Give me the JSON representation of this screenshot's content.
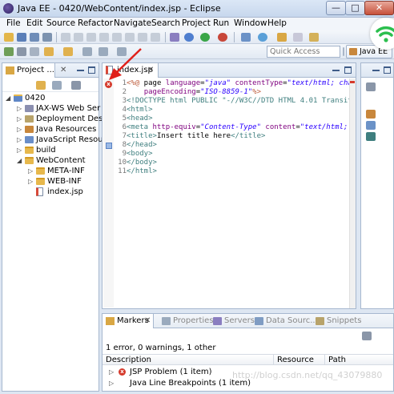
{
  "window": {
    "title": "Java EE - 0420/WebContent/index.jsp - Eclipse",
    "min_label": "—",
    "max_label": "□",
    "close_label": "✕"
  },
  "menu": {
    "items": [
      "File",
      "Edit",
      "Source",
      "Refactor",
      "Navigate",
      "Search",
      "Project",
      "Run",
      "Window",
      "Help"
    ]
  },
  "toolbar": {
    "quick_access_placeholder": "Quick Access",
    "perspective_label": "Java EE"
  },
  "project_explorer": {
    "tab_label": "Project ...",
    "tree": [
      {
        "label": "0420",
        "level": 0,
        "expanded": true,
        "icon": "project-icon"
      },
      {
        "label": "JAX-WS Web Ser",
        "level": 1,
        "expanded": false,
        "icon": "jaxws-icon"
      },
      {
        "label": "Deployment Desc",
        "level": 1,
        "expanded": false,
        "icon": "deployment-descriptor-icon"
      },
      {
        "label": "Java Resources",
        "level": 1,
        "expanded": false,
        "icon": "java-resources-icon"
      },
      {
        "label": "JavaScript Resou",
        "level": 1,
        "expanded": false,
        "icon": "javascript-resources-icon"
      },
      {
        "label": "build",
        "level": 1,
        "expanded": false,
        "icon": "folder-icon"
      },
      {
        "label": "WebContent",
        "level": 1,
        "expanded": true,
        "icon": "folder-icon"
      },
      {
        "label": "META-INF",
        "level": 2,
        "expanded": false,
        "icon": "folder-icon"
      },
      {
        "label": "WEB-INF",
        "level": 2,
        "expanded": false,
        "icon": "folder-icon"
      },
      {
        "label": "index.jsp",
        "level": 2,
        "expanded": null,
        "icon": "jsp-file-icon"
      }
    ]
  },
  "editor": {
    "tab_label": "index.jsp",
    "tab_close": "✕",
    "error_marker": "x",
    "lines": [
      {
        "n": "1",
        "parts": [
          [
            "dir",
            "<%@"
          ],
          [
            "txt",
            " page "
          ],
          [
            "attr",
            "language"
          ],
          [
            "txt",
            "="
          ],
          [
            "val",
            "\"java\""
          ],
          [
            "txt",
            " "
          ],
          [
            "attr",
            "contentType"
          ],
          [
            "txt",
            "="
          ],
          [
            "val",
            "\"text/html; char"
          ]
        ]
      },
      {
        "n": "2",
        "parts": [
          [
            "txt",
            "    "
          ],
          [
            "attr",
            "pageEncoding"
          ],
          [
            "txt",
            "="
          ],
          [
            "val",
            "\"ISO-8859-1\""
          ],
          [
            "dir",
            "%>"
          ]
        ]
      },
      {
        "n": "3",
        "parts": [
          [
            "doctype",
            "<!DOCTYPE html PUBLIC \"-//W3C//DTD HTML 4.01 Transiti"
          ]
        ]
      },
      {
        "n": "4",
        "parts": [
          [
            "tag",
            "<html>"
          ]
        ]
      },
      {
        "n": "5",
        "parts": [
          [
            "tag",
            "<head>"
          ]
        ]
      },
      {
        "n": "6",
        "parts": [
          [
            "tag",
            "<meta "
          ],
          [
            "attr",
            "http-equiv"
          ],
          [
            "txt",
            "="
          ],
          [
            "val",
            "\"Content-Type\""
          ],
          [
            "txt",
            " "
          ],
          [
            "attr",
            "content"
          ],
          [
            "txt",
            "="
          ],
          [
            "val",
            "\"text/html; c"
          ]
        ]
      },
      {
        "n": "7",
        "parts": [
          [
            "tag",
            "<title>"
          ],
          [
            "txt",
            "Insert title here"
          ],
          [
            "tag",
            "</title>"
          ]
        ]
      },
      {
        "n": "8",
        "parts": [
          [
            "tag",
            "</head>"
          ]
        ]
      },
      {
        "n": "9",
        "parts": [
          [
            "tag",
            "<body>"
          ]
        ]
      },
      {
        "n": "10",
        "parts": [
          [
            "tag",
            "</body>"
          ]
        ]
      },
      {
        "n": "11",
        "parts": [
          [
            "tag",
            "</html>"
          ]
        ]
      }
    ]
  },
  "markers_view": {
    "tabs": [
      "Markers",
      "Properties",
      "Servers",
      "Data Sourc...",
      "Snippets"
    ],
    "summary": "1 error, 0 warnings, 1 other",
    "columns": [
      "Description",
      "Resource",
      "Path"
    ],
    "rows": [
      {
        "label": "JSP Problem (1 item)",
        "icon": "error-icon"
      },
      {
        "label": "Java Line Breakpoints (1 item)",
        "icon": "breakpoint-icon"
      }
    ]
  },
  "watermark": "http://blog.csdn.net/qq_43079880",
  "colors": {
    "window_bg": "#dde6f2",
    "error_red": "#d53a2c",
    "tag_teal": "#3f7f7f",
    "attr_purple": "#7f007f",
    "value_blue": "#2a00ff",
    "annotation_red": "#e0201a",
    "wifi_green": "#2bbf4e"
  }
}
